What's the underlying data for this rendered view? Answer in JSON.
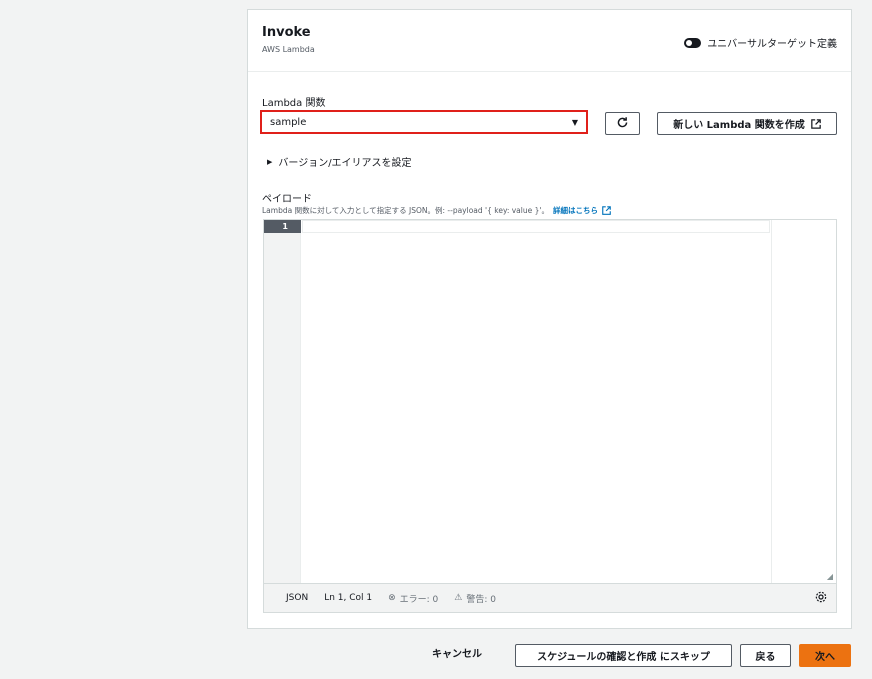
{
  "header": {
    "title": "Invoke",
    "subtitle": "AWS Lambda",
    "toggle_label": "ユニバーサルターゲット定義"
  },
  "lambda_function": {
    "label": "Lambda 関数",
    "selected": "sample",
    "new_button_label": "新しい Lambda 関数を作成",
    "icons": {
      "refresh": "refresh-icon",
      "external": "external-link-icon",
      "caret": "caret-down-icon"
    }
  },
  "version_alias": {
    "label": "バージョン/エイリアスを設定"
  },
  "payload": {
    "label": "ペイロード",
    "description": "Lambda 関数に対して入力として指定する JSON。例: --payload '{ key: value }'。",
    "link_label": "詳細はこちら",
    "editor": {
      "line_number": "1",
      "mode": "JSON",
      "cursor": "Ln 1, Col 1",
      "errors_label": "エラー: 0",
      "warnings_label": "警告: 0"
    }
  },
  "footer": {
    "cancel_label": "キャンセル",
    "skip_label": "スケジュールの確認と作成 にスキップ",
    "back_label": "戻る",
    "next_label": "次へ"
  },
  "colors": {
    "highlight_border": "#e0201a",
    "primary_button": "#ec7211",
    "link": "#0073bb"
  }
}
